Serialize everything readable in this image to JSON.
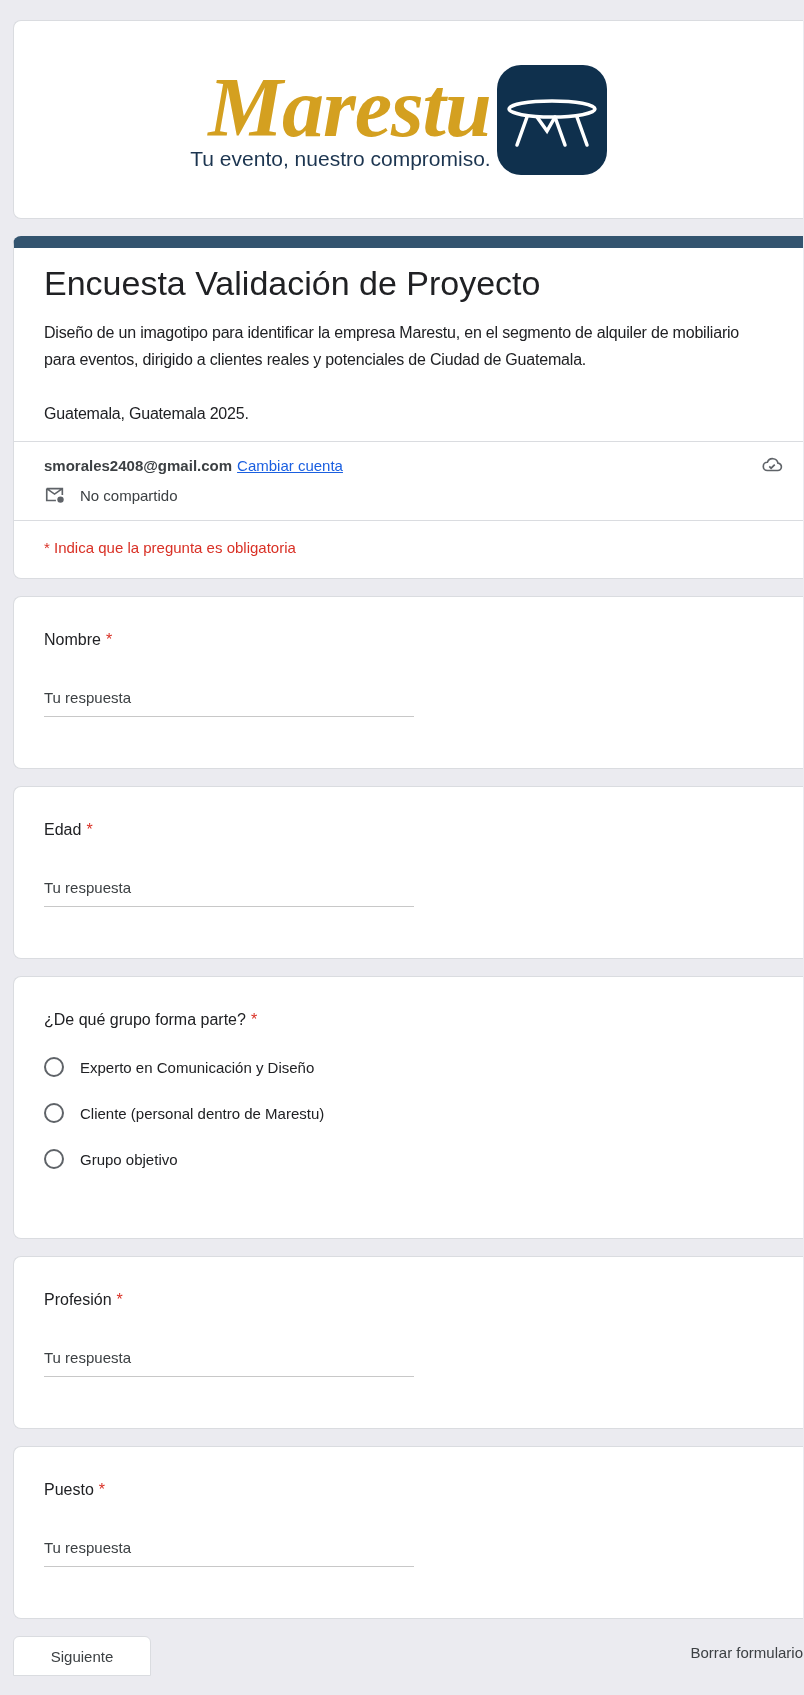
{
  "header": {
    "logo_text": "Marestu",
    "tagline": "Tu evento, nuestro compromiso."
  },
  "form": {
    "title": "Encuesta Validación de Proyecto",
    "description": "Diseño de un imagotipo para identificar la empresa Marestu, en el segmento de alquiler de mobiliario para eventos, dirigido a clientes reales y potenciales de Ciudad de Guatemala.",
    "location": "Guatemala, Guatemala 2025.",
    "account": {
      "email": "smorales2408@gmail.com",
      "switch_link": "Cambiar cuenta",
      "sharing": "No compartido"
    },
    "required_note": "* Indica que la pregunta es obligatoria"
  },
  "questions": [
    {
      "kind": "text",
      "label": "Nombre",
      "required_mark": "*",
      "placeholder": "Tu respuesta"
    },
    {
      "kind": "text",
      "label": "Edad",
      "required_mark": "*",
      "placeholder": "Tu respuesta"
    },
    {
      "kind": "radio",
      "label": "¿De qué grupo forma parte?",
      "required_mark": "*",
      "options": [
        {
          "label": "Experto en Comunicación y Diseño",
          "selected": false
        },
        {
          "label": "Cliente (personal dentro de Marestu)",
          "selected": false
        },
        {
          "label": "Grupo objetivo",
          "selected": false
        }
      ]
    },
    {
      "kind": "text",
      "label": "Profesión",
      "required_mark": "*",
      "placeholder": "Tu respuesta"
    },
    {
      "kind": "text",
      "label": "Puesto",
      "required_mark": "*",
      "placeholder": "Tu respuesta"
    }
  ],
  "footer": {
    "next_button": "Siguiente",
    "clear_button": "Borrar formulario"
  }
}
